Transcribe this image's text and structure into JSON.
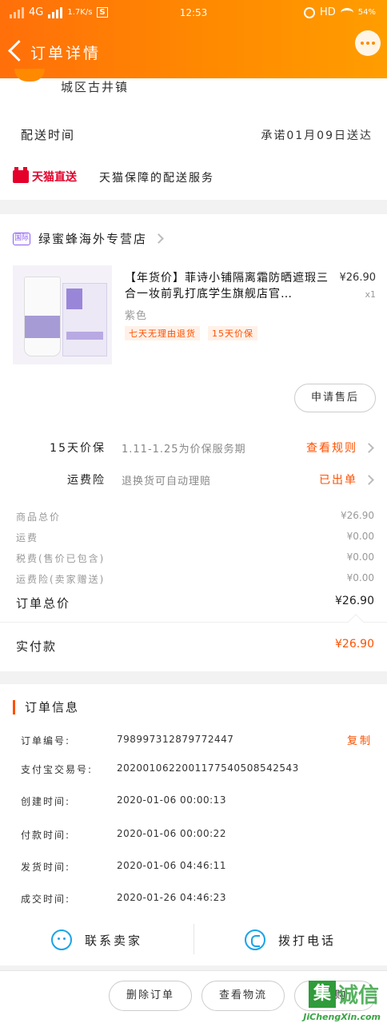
{
  "status_bar": {
    "network": "4G",
    "speed": "1.7K/s",
    "time": "12:53",
    "hd": "HD",
    "battery": "54%"
  },
  "header": {
    "title": "订单详情"
  },
  "address": {
    "tail": "城区古井镇"
  },
  "delivery": {
    "label": "配送时间",
    "value": "承诺01月09日送达"
  },
  "tmall": {
    "logo": "天猫直送",
    "text": "天猫保障的配送服务"
  },
  "shop": {
    "badge": "国际",
    "name": "绿蜜蜂海外专营店"
  },
  "product": {
    "name": "【年货价】菲诗小铺隔离霜防晒遮瑕三合一妆前乳打底学生旗舰店官…",
    "price": "¥26.90",
    "qty": "x1",
    "variant": "紫色",
    "tags": [
      "七天无理由退货",
      "15天价保"
    ],
    "after_sale": "申请售后"
  },
  "services": [
    {
      "key": "15天价保",
      "value": "1.11-1.25为价保服务期",
      "action": "查看规则"
    },
    {
      "key": "运费险",
      "value": "退换货可自动理赔",
      "action": "已出单"
    }
  ],
  "fees": [
    {
      "key": "商品总价",
      "value": "¥26.90"
    },
    {
      "key": "运费",
      "value": "¥0.00"
    },
    {
      "key": "税费(售价已包含)",
      "value": "¥0.00"
    },
    {
      "key": "运费险(卖家赠送)",
      "value": "¥0.00"
    }
  ],
  "order_total": {
    "key": "订单总价",
    "value": "¥26.90"
  },
  "paid": {
    "key": "实付款",
    "value": "¥26.90"
  },
  "order_info": {
    "title": "订单信息",
    "copy": "复制",
    "rows": [
      {
        "key": "订单编号:",
        "value": "798997312879772447"
      },
      {
        "key": "支付宝交易号:",
        "value": "2020010622001177540508542543"
      },
      {
        "key": "创建时间:",
        "value": "2020-01-06 00:00:13"
      },
      {
        "key": "付款时间:",
        "value": "2020-01-06 00:00:22"
      },
      {
        "key": "发货时间:",
        "value": "2020-01-06 04:46:11"
      },
      {
        "key": "成交时间:",
        "value": "2020-01-26 04:46:23"
      }
    ]
  },
  "contact": {
    "seller": "联系卖家",
    "phone": "拨打电话"
  },
  "bottom": {
    "delete": "删除订单",
    "logistics": "查看物流",
    "third_partial": "加购"
  },
  "watermark": {
    "mark": "集",
    "text": "诚信",
    "url": "JiChengXin.com"
  },
  "colors": {
    "header_start": "#ff6f0a",
    "header_end": "#ff9d00",
    "accent": "#ff5000",
    "tmall_red": "#e4002b",
    "contact_blue": "#1aa3e8"
  }
}
